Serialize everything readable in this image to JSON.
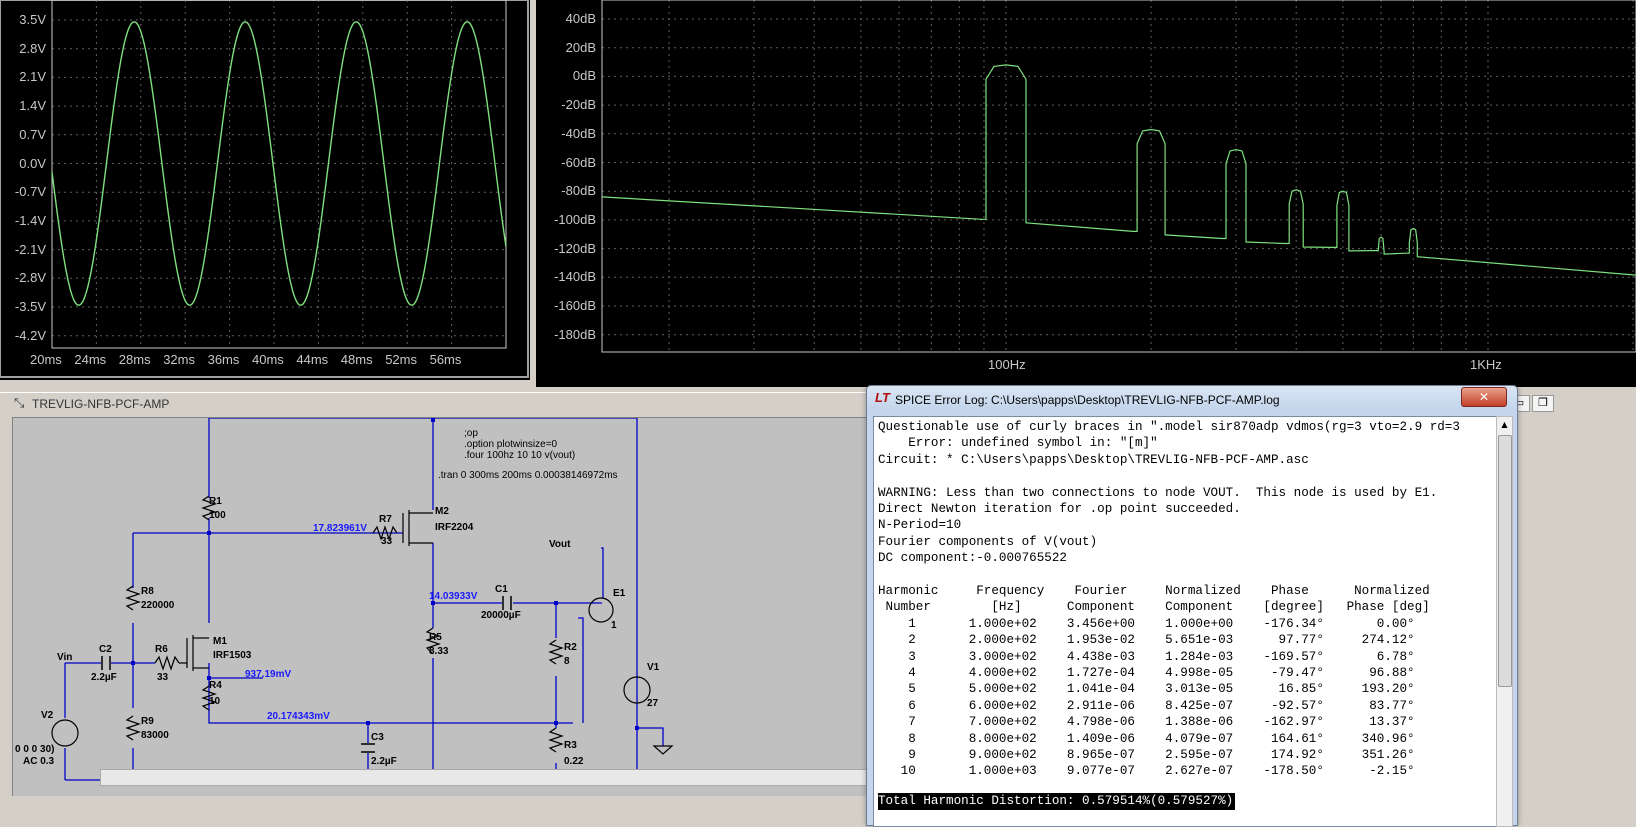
{
  "waveform": {
    "y_ticks": [
      "3.5V",
      "2.8V",
      "2.1V",
      "1.4V",
      "0.7V",
      "0.0V",
      "-0.7V",
      "-1.4V",
      "-2.1V",
      "-2.8V",
      "-3.5V",
      "-4.2V"
    ],
    "x_ticks": [
      "20ms",
      "24ms",
      "28ms",
      "32ms",
      "36ms",
      "40ms",
      "44ms",
      "48ms",
      "52ms",
      "56ms"
    ],
    "trace_color": "#7fe07f"
  },
  "spectrum": {
    "y_ticks": [
      "40dB",
      "20dB",
      "0dB",
      "-20dB",
      "-40dB",
      "-60dB",
      "-80dB",
      "-100dB",
      "-120dB",
      "-140dB",
      "-160dB",
      "-180dB"
    ],
    "x_ticks": [
      "100Hz",
      "1KHz"
    ],
    "trace_color": "#7fe07f"
  },
  "schematic_window": {
    "title": "TREVLIG-NFB-PCF-AMP",
    "directives": [
      ";op",
      ".option plotwinsize=0",
      ".four 100hz 10 10 v(vout)",
      ".tran 0 300ms 200ms 0.00038146972ms"
    ],
    "components": {
      "r1": "R1",
      "r1v": "100",
      "r7": "R7",
      "r7v": "33",
      "m2": "M2",
      "m2v": "IRF2204",
      "r8": "R8",
      "r8v": "220000",
      "m1": "M1",
      "m1v": "IRF1503",
      "r6": "R6",
      "r6v": "33",
      "c2": "C2",
      "c2v": "2.2µF",
      "r4": "R4",
      "r4v": "10",
      "r9": "R9",
      "r9v": "83000",
      "v2": "V2",
      "v2a": "0 0 0 30)",
      "v2b": "AC 0.3",
      "vin": "Vin",
      "c1": "C1",
      "c1v": "20000µF",
      "r5": "R5",
      "r5v": "8.33",
      "r2": "R2",
      "r2v": "8",
      "r3": "R3",
      "r3v": "0.22",
      "c3": "C3",
      "c3v": "2.2µF",
      "e1": "E1",
      "e1v": "1",
      "v1": "V1",
      "v1v": "27",
      "vout": "Vout"
    },
    "node_voltages": {
      "n1": "17.823961V",
      "n2": "14.03933V",
      "n3": "937.19mV",
      "n4": "20.174343mV"
    }
  },
  "error_log": {
    "title": "SPICE Error Log: C:\\Users\\papps\\Desktop\\TREVLIG-NFB-PCF-AMP.log",
    "lines": [
      "Questionable use of curly braces in \".model sir870adp vdmos(rg=3 vto=2.9 rd=3",
      "    Error: undefined symbol in: \"[m]\"",
      "Circuit: * C:\\Users\\papps\\Desktop\\TREVLIG-NFB-PCF-AMP.asc",
      "",
      "WARNING: Less than two connections to node VOUT.  This node is used by E1.",
      "Direct Newton iteration for .op point succeeded.",
      "N-Period=10",
      "Fourier components of V(vout)",
      "DC component:-0.000765522",
      "",
      "Harmonic     Frequency    Fourier     Normalized    Phase      Normalized",
      " Number        [Hz]      Component    Component    [degree]   Phase [deg]",
      "    1       1.000e+02    3.456e+00    1.000e+00    -176.34°       0.00°",
      "    2       2.000e+02    1.953e-02    5.651e-03      97.77°     274.12°",
      "    3       3.000e+02    4.438e-03    1.284e-03    -169.57°       6.78°",
      "    4       4.000e+02    1.727e-04    4.998e-05     -79.47°      96.88°",
      "    5       5.000e+02    1.041e-04    3.013e-05      16.85°     193.20°",
      "    6       6.000e+02    2.911e-06    8.425e-07     -92.57°      83.77°",
      "    7       7.000e+02    4.798e-06    1.388e-06    -162.97°      13.37°",
      "    8       8.000e+02    1.409e-06    4.079e-07     164.61°     340.96°",
      "    9       9.000e+02    8.965e-07    2.595e-07     174.92°     351.26°",
      "   10       1.000e+03    9.077e-07    2.627e-07    -178.50°      -2.15°"
    ],
    "thd_line": "Total Harmonic Distortion: 0.579514%(0.579527%)",
    "close_glyph": "✕"
  },
  "mdi_buttons": {
    "minimize_glyph": "▭",
    "restore_glyph": "❐"
  }
}
